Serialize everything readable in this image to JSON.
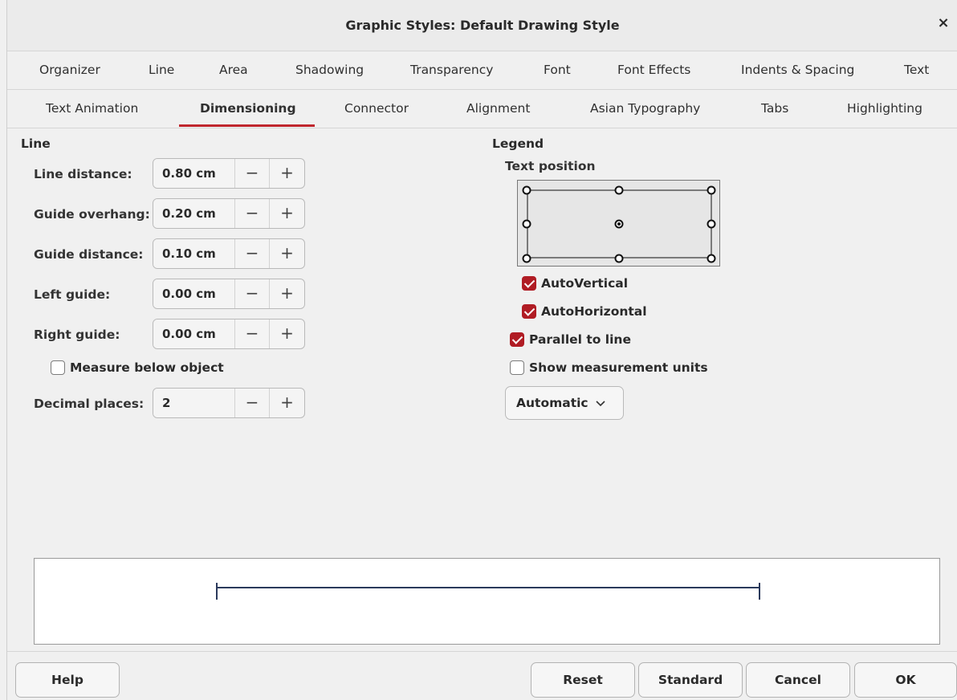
{
  "window": {
    "title": "Graphic Styles: Default Drawing Style",
    "close_glyph": "×"
  },
  "tabs_row1": [
    "Organizer",
    "Line",
    "Area",
    "Shadowing",
    "Transparency",
    "Font",
    "Font Effects",
    "Indents & Spacing",
    "Text"
  ],
  "tabs_row2": [
    "Text Animation",
    "Dimensioning",
    "Connector",
    "Alignment",
    "Asian Typography",
    "Tabs",
    "Highlighting"
  ],
  "active_tab": "Dimensioning",
  "line_section": {
    "title": "Line",
    "fields": [
      {
        "label": "Line distance:",
        "value": "0.80 cm"
      },
      {
        "label": "Guide overhang:",
        "value": "0.20 cm"
      },
      {
        "label": "Guide distance:",
        "value": "0.10 cm"
      },
      {
        "label": "Left guide:",
        "value": "0.00 cm"
      },
      {
        "label": "Right guide:",
        "value": "0.00 cm"
      }
    ],
    "measure_below": {
      "label": "Measure below object",
      "checked": false
    },
    "decimal": {
      "label": "Decimal places:",
      "value": "2"
    },
    "minus_glyph": "−",
    "plus_glyph": "+"
  },
  "legend_section": {
    "title": "Legend",
    "text_position_label": "Text position",
    "selected_position": "center",
    "auto_vertical": {
      "label": "AutoVertical",
      "checked": true
    },
    "auto_horizontal": {
      "label": "AutoHorizontal",
      "checked": true
    },
    "parallel": {
      "label": "Parallel to line",
      "checked": true
    },
    "show_units": {
      "label": "Show measurement units",
      "checked": false
    },
    "unit_dropdown": {
      "value": "Automatic"
    }
  },
  "buttons": {
    "help": "Help",
    "reset": "Reset",
    "standard": "Standard",
    "cancel": "Cancel",
    "ok": "OK"
  },
  "colors": {
    "accent": "#c0262d",
    "checkbox": "#b01c24",
    "preview_line": "#2b3a5c"
  }
}
